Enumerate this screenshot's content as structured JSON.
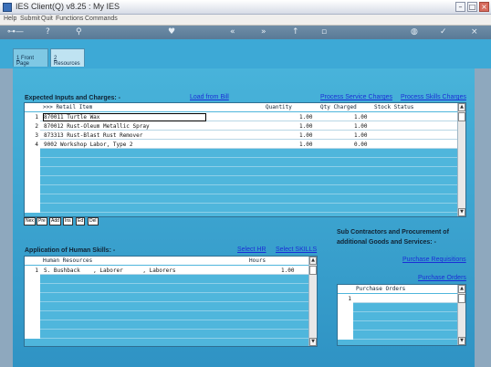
{
  "window": {
    "title": "IES Client(Q) v8.25 : My IES",
    "min": "–",
    "max": "□",
    "close": "×"
  },
  "menu": [
    "Help",
    "Submit",
    "Quit",
    "Functions",
    "Commands"
  ],
  "toolbar": [
    "key-icon",
    "help-icon",
    "search-icon",
    "heart-icon",
    "back-icon",
    "forward-icon",
    "up-icon",
    "page-icon",
    "globe-icon",
    "check-icon",
    "close-icon"
  ],
  "tabs": [
    {
      "key": "1",
      "label": "Front Page"
    },
    {
      "key": "2",
      "label": "Resources"
    }
  ],
  "expected": {
    "label": "Expected Inputs and Charges: -",
    "load_link": "Load from Bill",
    "service_link": "Process Service Charges",
    "skills_link": "Process Skills Charges",
    "columns": [
      ">>> Retail Item",
      "Quantity",
      "Qty Charged",
      "Stock Status"
    ],
    "rows": [
      {
        "num": "1",
        "item": "870011 Turtle Wax",
        "qty": "1.00",
        "charged": "1.00",
        "status": ""
      },
      {
        "num": "2",
        "item": "870012 Rust-Oleum Metallic Spray",
        "qty": "1.00",
        "charged": "1.00",
        "status": ""
      },
      {
        "num": "3",
        "item": "873313 Rust-Blast Rust Remover",
        "qty": "1.00",
        "charged": "1.00",
        "status": ""
      },
      {
        "num": "4",
        "item": "9002 Workshop Labor, Type 2",
        "qty": "1.00",
        "charged": "0.00",
        "status": ""
      }
    ],
    "nav": [
      "Nex",
      "Pre",
      "Add",
      "Ins",
      "Ed",
      "Del"
    ]
  },
  "skills": {
    "label": "Application of Human Skills: -",
    "select_hr": "Select HR",
    "select_skills": "Select SKILLS",
    "columns": [
      "Human Resources",
      "Hours"
    ],
    "rows": [
      {
        "num": "1",
        "resource": "S. Bushback    , Laborer      , Laborers",
        "hours": "1.00"
      }
    ]
  },
  "subcontract": {
    "label_line1": "Sub Contractors and Procurement of",
    "label_line2": "additional Goods and Services: -",
    "req_link": "Purchase Requisitions",
    "orders_link": "Purchase Orders",
    "columns": [
      "Purchase Orders"
    ],
    "rows": [
      {
        "num": "1",
        "order": ""
      }
    ]
  }
}
